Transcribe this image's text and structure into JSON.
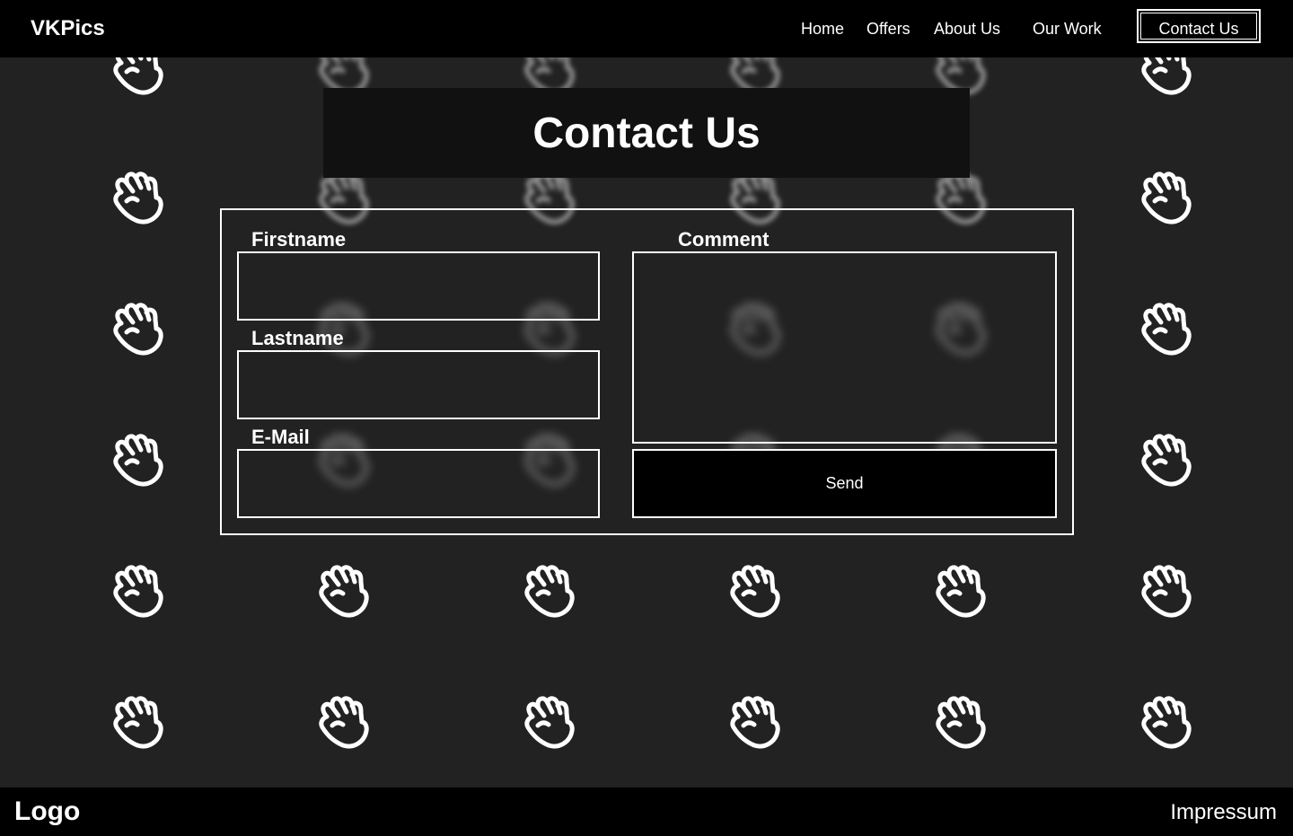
{
  "nav": {
    "brand": "VKPics",
    "links": [
      "Home",
      "Offers",
      "About Us",
      "Our Work"
    ],
    "contact_button": "Contact Us"
  },
  "page": {
    "title": "Contact Us"
  },
  "form": {
    "firstname_label": "Firstname",
    "firstname_value": "",
    "lastname_label": "Lastname",
    "lastname_value": "",
    "email_label": "E-Mail",
    "email_value": "",
    "comment_label": "Comment",
    "comment_value": "",
    "send_label": "Send"
  },
  "footer": {
    "logo": "Logo",
    "impressum": "Impressum"
  },
  "background": {
    "icon": "hand-icon",
    "color": "#222222"
  },
  "colors": {
    "nav_bg": "#000000",
    "text": "#ffffff",
    "panel_bg": "#111111"
  }
}
